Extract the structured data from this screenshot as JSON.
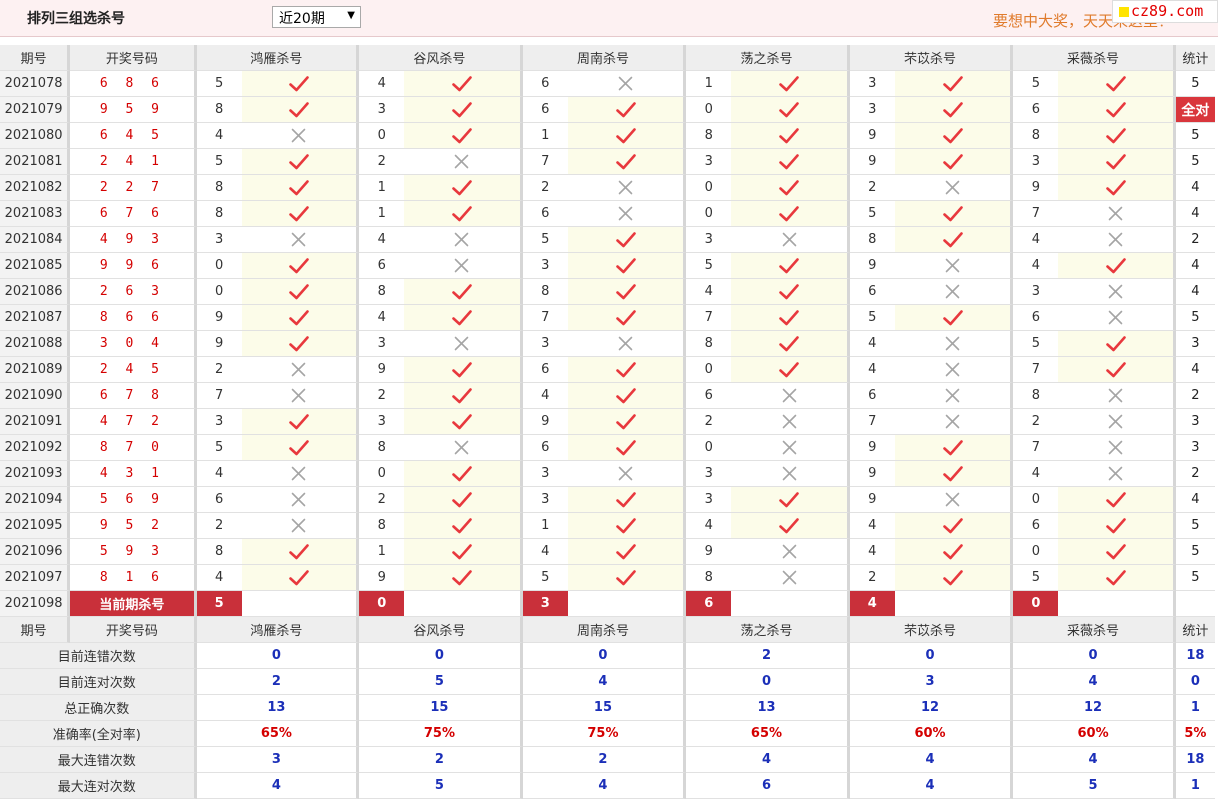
{
  "header": {
    "title": "排列三组选杀号",
    "range_selected": "近20期",
    "slogan": "要想中大奖，天天来这里！",
    "site": "cz89.com"
  },
  "columns": {
    "period": "期号",
    "draw": "开奖号码",
    "experts": [
      "鸿雁杀号",
      "谷风杀号",
      "周南杀号",
      "荡之杀号",
      "芣苡杀号",
      "采薇杀号"
    ],
    "stats": "统计"
  },
  "rows": [
    {
      "period": "2021078",
      "draw": "6 8 6",
      "kills": [
        "5",
        "4",
        "6",
        "1",
        "3",
        "5"
      ],
      "ok": [
        1,
        1,
        0,
        1,
        1,
        1
      ],
      "stat": "5"
    },
    {
      "period": "2021079",
      "draw": "9 5 9",
      "kills": [
        "8",
        "3",
        "6",
        "0",
        "3",
        "6"
      ],
      "ok": [
        1,
        1,
        1,
        1,
        1,
        1
      ],
      "stat": "全对"
    },
    {
      "period": "2021080",
      "draw": "6 4 5",
      "kills": [
        "4",
        "0",
        "1",
        "8",
        "9",
        "8"
      ],
      "ok": [
        0,
        1,
        1,
        1,
        1,
        1
      ],
      "stat": "5"
    },
    {
      "period": "2021081",
      "draw": "2 4 1",
      "kills": [
        "5",
        "2",
        "7",
        "3",
        "9",
        "3"
      ],
      "ok": [
        1,
        0,
        1,
        1,
        1,
        1
      ],
      "stat": "5"
    },
    {
      "period": "2021082",
      "draw": "2 2 7",
      "kills": [
        "8",
        "1",
        "2",
        "0",
        "2",
        "9"
      ],
      "ok": [
        1,
        1,
        0,
        1,
        0,
        1
      ],
      "stat": "4"
    },
    {
      "period": "2021083",
      "draw": "6 7 6",
      "kills": [
        "8",
        "1",
        "6",
        "0",
        "5",
        "7"
      ],
      "ok": [
        1,
        1,
        0,
        1,
        1,
        0
      ],
      "stat": "4"
    },
    {
      "period": "2021084",
      "draw": "4 9 3",
      "kills": [
        "3",
        "4",
        "5",
        "3",
        "8",
        "4"
      ],
      "ok": [
        0,
        0,
        1,
        0,
        1,
        0
      ],
      "stat": "2"
    },
    {
      "period": "2021085",
      "draw": "9 9 6",
      "kills": [
        "0",
        "6",
        "3",
        "5",
        "9",
        "4"
      ],
      "ok": [
        1,
        0,
        1,
        1,
        0,
        1
      ],
      "stat": "4"
    },
    {
      "period": "2021086",
      "draw": "2 6 3",
      "kills": [
        "0",
        "8",
        "8",
        "4",
        "6",
        "3"
      ],
      "ok": [
        1,
        1,
        1,
        1,
        0,
        0
      ],
      "stat": "4"
    },
    {
      "period": "2021087",
      "draw": "8 6 6",
      "kills": [
        "9",
        "4",
        "7",
        "7",
        "5",
        "6"
      ],
      "ok": [
        1,
        1,
        1,
        1,
        1,
        0
      ],
      "stat": "5"
    },
    {
      "period": "2021088",
      "draw": "3 0 4",
      "kills": [
        "9",
        "3",
        "3",
        "8",
        "4",
        "5"
      ],
      "ok": [
        1,
        0,
        0,
        1,
        0,
        1
      ],
      "stat": "3"
    },
    {
      "period": "2021089",
      "draw": "2 4 5",
      "kills": [
        "2",
        "9",
        "6",
        "0",
        "4",
        "7"
      ],
      "ok": [
        0,
        1,
        1,
        1,
        0,
        1
      ],
      "stat": "4"
    },
    {
      "period": "2021090",
      "draw": "6 7 8",
      "kills": [
        "7",
        "2",
        "4",
        "6",
        "6",
        "8"
      ],
      "ok": [
        0,
        1,
        1,
        0,
        0,
        0
      ],
      "stat": "2"
    },
    {
      "period": "2021091",
      "draw": "4 7 2",
      "kills": [
        "3",
        "3",
        "9",
        "2",
        "7",
        "2"
      ],
      "ok": [
        1,
        1,
        1,
        0,
        0,
        0
      ],
      "stat": "3"
    },
    {
      "period": "2021092",
      "draw": "8 7 0",
      "kills": [
        "5",
        "8",
        "6",
        "0",
        "9",
        "7"
      ],
      "ok": [
        1,
        0,
        1,
        0,
        1,
        0
      ],
      "stat": "3"
    },
    {
      "period": "2021093",
      "draw": "4 3 1",
      "kills": [
        "4",
        "0",
        "3",
        "3",
        "9",
        "4"
      ],
      "ok": [
        0,
        1,
        0,
        0,
        1,
        0
      ],
      "stat": "2"
    },
    {
      "period": "2021094",
      "draw": "5 6 9",
      "kills": [
        "6",
        "2",
        "3",
        "3",
        "9",
        "0"
      ],
      "ok": [
        0,
        1,
        1,
        1,
        0,
        1
      ],
      "stat": "4"
    },
    {
      "period": "2021095",
      "draw": "9 5 2",
      "kills": [
        "2",
        "8",
        "1",
        "4",
        "4",
        "6"
      ],
      "ok": [
        0,
        1,
        1,
        1,
        1,
        1
      ],
      "stat": "5"
    },
    {
      "period": "2021096",
      "draw": "5 9 3",
      "kills": [
        "8",
        "1",
        "4",
        "9",
        "4",
        "0"
      ],
      "ok": [
        1,
        1,
        1,
        0,
        1,
        1
      ],
      "stat": "5"
    },
    {
      "period": "2021097",
      "draw": "8 1 6",
      "kills": [
        "4",
        "9",
        "5",
        "8",
        "2",
        "5"
      ],
      "ok": [
        1,
        1,
        1,
        0,
        1,
        1
      ],
      "stat": "5"
    }
  ],
  "current": {
    "period": "2021098",
    "label": "当前期杀号",
    "kills": [
      "5",
      "0",
      "3",
      "6",
      "4",
      "0"
    ]
  },
  "summary": [
    {
      "label": "目前连错次数",
      "values": [
        "0",
        "0",
        "0",
        "2",
        "0",
        "0"
      ],
      "stat": "18",
      "rate": false
    },
    {
      "label": "目前连对次数",
      "values": [
        "2",
        "5",
        "4",
        "0",
        "3",
        "4"
      ],
      "stat": "0",
      "rate": false
    },
    {
      "label": "总正确次数",
      "values": [
        "13",
        "15",
        "15",
        "13",
        "12",
        "12"
      ],
      "stat": "1",
      "rate": false
    },
    {
      "label": "准确率(全对率)",
      "values": [
        "65%",
        "75%",
        "75%",
        "65%",
        "60%",
        "60%"
      ],
      "stat": "5%",
      "rate": true
    },
    {
      "label": "最大连错次数",
      "values": [
        "3",
        "2",
        "2",
        "4",
        "4",
        "4"
      ],
      "stat": "18",
      "rate": false
    },
    {
      "label": "最大连对次数",
      "values": [
        "4",
        "5",
        "4",
        "6",
        "4",
        "5"
      ],
      "stat": "1",
      "rate": false
    }
  ],
  "icons": {
    "correct": "check-icon",
    "wrong": "cross-icon"
  },
  "colors": {
    "check": "#e8383d",
    "cross": "#a5a5a5",
    "highlight": "#c9303a",
    "blue_value": "#1b2fb8"
  }
}
